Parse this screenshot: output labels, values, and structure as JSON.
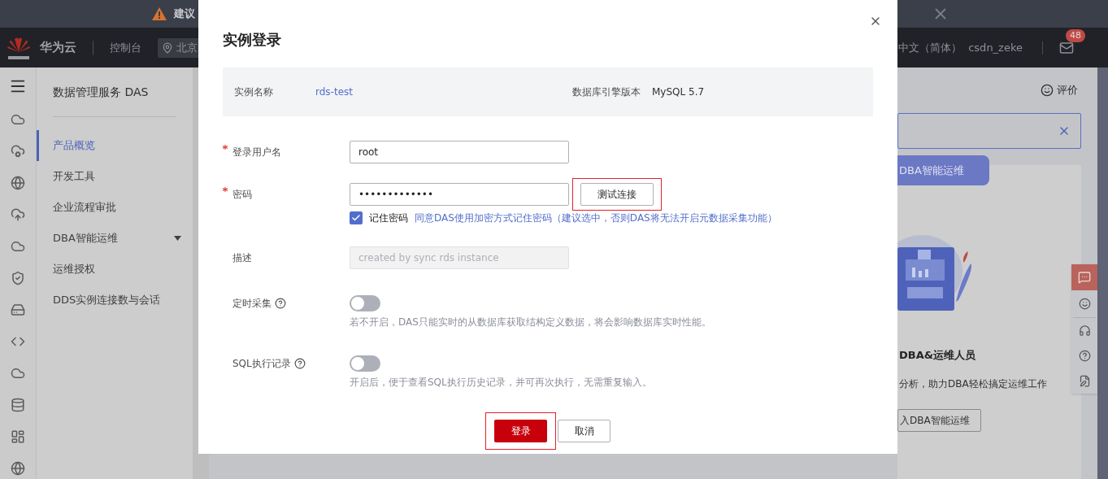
{
  "notice_bar": {
    "text": "建议"
  },
  "header": {
    "brand": "华为云",
    "console": "控制台",
    "region": "北京",
    "language": "中文（简体）",
    "user": "csdn_zeke",
    "mail_badge": "48"
  },
  "sidebar": {
    "title": "数据管理服务 DAS",
    "items": [
      {
        "label": "产品概览",
        "selected": true,
        "expandable": false
      },
      {
        "label": "开发工具",
        "selected": false,
        "expandable": false
      },
      {
        "label": "企业流程审批",
        "selected": false,
        "expandable": false
      },
      {
        "label": "DBA智能运维",
        "selected": false,
        "expandable": true
      },
      {
        "label": "运维授权",
        "selected": false,
        "expandable": false
      },
      {
        "label": "DDS实例连接数与会话",
        "selected": false,
        "expandable": false
      }
    ]
  },
  "content": {
    "feedback": "评价",
    "tab": "DBA智能运维",
    "heading": "DBA&运维人员",
    "description": "分析，助力DBA轻松搞定运维工作",
    "button": "入DBA智能运维"
  },
  "dialog": {
    "title": "实例登录",
    "info": [
      {
        "label": "实例名称",
        "value": "rds-test",
        "kind": "link"
      },
      {
        "label": "数据库引擎版本",
        "value": "MySQL 5.7",
        "kind": "text"
      }
    ],
    "fields": [
      {
        "label": "登录用户名",
        "required": true,
        "value": "root",
        "disabled": false
      },
      {
        "label": "密码",
        "required": true,
        "value": "•••••••••••••",
        "disabled": false
      }
    ],
    "test_button": "测试连接",
    "remember": {
      "checked": true,
      "label": "记住密码",
      "note": "同意DAS使用加密方式记住密码（建议选中，否则DAS将无法开启元数据采集功能）"
    },
    "description": {
      "label": "描述",
      "value": "created by sync rds instance",
      "disabled": true
    },
    "toggles": [
      {
        "label": "定时采集",
        "on": false,
        "hint": "若不开启，DAS只能实时的从数据库获取结构定义数据，将会影响数据库实时性能。"
      },
      {
        "label": "SQL执行记录",
        "on": false,
        "hint": "开启后，便于查看SQL执行历史记录，并可再次执行，无需重复输入。"
      }
    ],
    "buttons": [
      {
        "label": "登录",
        "kind": "primary"
      },
      {
        "label": "取消",
        "kind": "default"
      }
    ]
  }
}
